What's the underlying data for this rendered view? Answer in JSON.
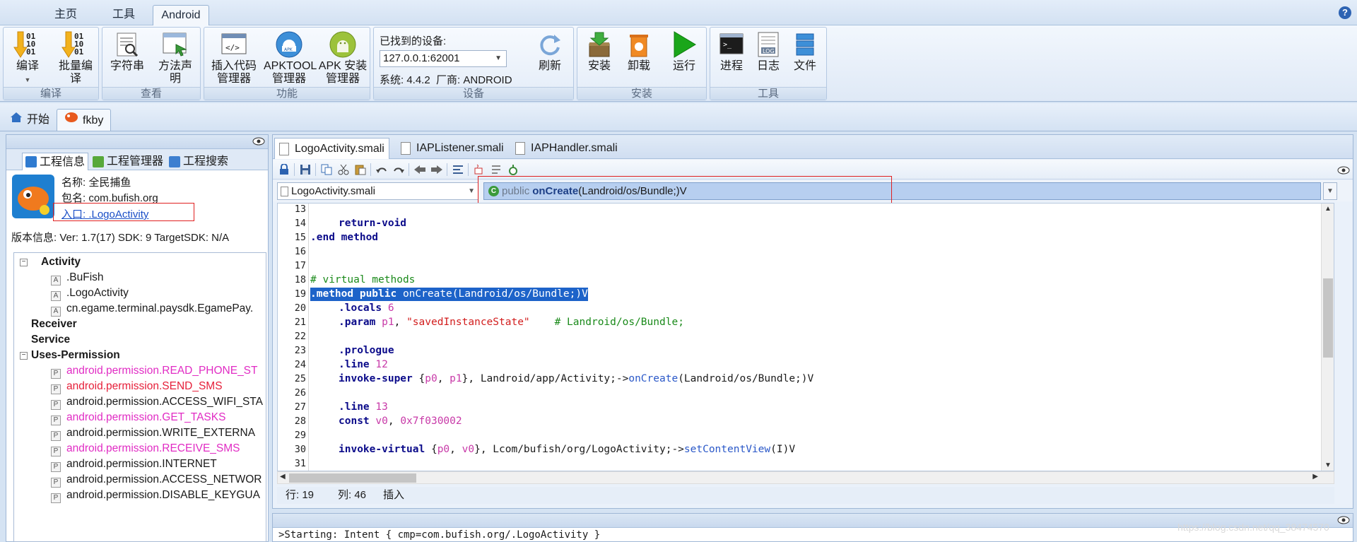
{
  "menu": {
    "tabs": [
      "主页",
      "工具",
      "Android"
    ],
    "active": "Android"
  },
  "ribbon": {
    "groups": [
      {
        "label": "编译",
        "buttons": [
          "编译",
          "批量编译"
        ]
      },
      {
        "label": "查看",
        "buttons": [
          "字符串",
          "方法声明"
        ]
      },
      {
        "label": "功能",
        "buttons": [
          "插入代码管理器",
          "APKTOOL管理器",
          "APK 安装管理器"
        ]
      },
      {
        "label": "设备",
        "found_label": "已找到的设备:",
        "device": "127.0.0.1:62001",
        "system_info": "系统: 4.4.2  厂商: ANDROID",
        "buttons": [
          "刷新"
        ]
      },
      {
        "label": "安装",
        "buttons": [
          "安装",
          "卸载",
          "运行"
        ]
      },
      {
        "label": "工具",
        "buttons": [
          "进程",
          "日志",
          "文件"
        ]
      }
    ],
    "log_badge": "LOG"
  },
  "doc_tabs": [
    "开始",
    "fkby"
  ],
  "left": {
    "tabs": [
      "工程信息",
      "工程管理器",
      "工程搜索"
    ],
    "app": {
      "name": "名称: 全民捕鱼",
      "package": "包名: com.bufish.org",
      "entry": "入口: .LogoActivity"
    },
    "version": "版本信息: Ver: 1.7(17) SDK: 9 TargetSDK: N/A",
    "tree": {
      "activity_header": "Activity",
      "activities": [
        ".BuFish",
        ".LogoActivity",
        "cn.egame.terminal.paysdk.EgamePay."
      ],
      "receiver": "Receiver",
      "service": "Service",
      "perm_header": "Uses-Permission",
      "permissions": [
        "android.permission.READ_PHONE_ST",
        "android.permission.SEND_SMS",
        "android.permission.ACCESS_WIFI_STA",
        "android.permission.GET_TASKS",
        "android.permission.WRITE_EXTERNA",
        "android.permission.RECEIVE_SMS",
        "android.permission.INTERNET",
        "android.permission.ACCESS_NETWOR",
        "android.permission.DISABLE_KEYGUA"
      ],
      "item_badge_activity": "A",
      "item_badge_perm": "P"
    }
  },
  "editor": {
    "file_tabs": [
      "LogoActivity.smali",
      "IAPListener.smali",
      "IAPHandler.smali"
    ],
    "class_combo": "LogoActivity.smali",
    "method_combo": {
      "modifier": "public",
      "name": "onCreate",
      "sig": "(Landroid/os/Bundle;)V"
    },
    "line_numbers": [
      "13",
      "14",
      "15",
      "16",
      "17",
      "18",
      "19",
      "20",
      "21",
      "22",
      "23",
      "24",
      "25",
      "26",
      "27",
      "28",
      "29",
      "30",
      "31"
    ],
    "code": {
      "l14_kw": "return-void",
      "l15_dir": ".end method",
      "l18_cm": "# virtual methods",
      "l19_a": ".method public ",
      "l19_b": "onCreate",
      "l19_c": "(Landroid/os/Bundle;)V",
      "l20_dir": ".locals",
      "l20_num": "6",
      "l21_dir": ".param",
      "l21_reg": "p1",
      "l21_comma": ",",
      "l21_str": "\"savedInstanceState\"",
      "l21_cm": "# Landroid/os/Bundle;",
      "l23_dir": ".prologue",
      "l24_dir": ".line",
      "l24_num": "12",
      "l25_kw": "invoke-super",
      "l25_open": "{",
      "l25_r1": "p0",
      "l25_mid": ", ",
      "l25_r2": "p1",
      "l25_close": "}, Landroid/app/Activity;->",
      "l25_fn": "onCreate",
      "l25_tail": "(Landroid/os/Bundle;)V",
      "l27_dir": ".line",
      "l27_num": "13",
      "l28_kw": "const",
      "l28_reg": "v0",
      "l28_comma": ",",
      "l28_num": "0x7f030002",
      "l30_kw": "invoke-virtual",
      "l30_open": "{",
      "l30_r1": "p0",
      "l30_mid": ", ",
      "l30_r2": "v0",
      "l30_close": "}, Lcom/bufish/org/LogoActivity;->",
      "l30_fn": "setContentView",
      "l30_tail": "(I)V"
    },
    "status": {
      "row": "行: 19",
      "col": "列: 46",
      "mode": "插入"
    }
  },
  "output": {
    "text": ">Starting: Intent { cmp=com.bufish.org/.LogoActivity }"
  },
  "watermark": "https://blog.csdn.net/qq_38474570"
}
